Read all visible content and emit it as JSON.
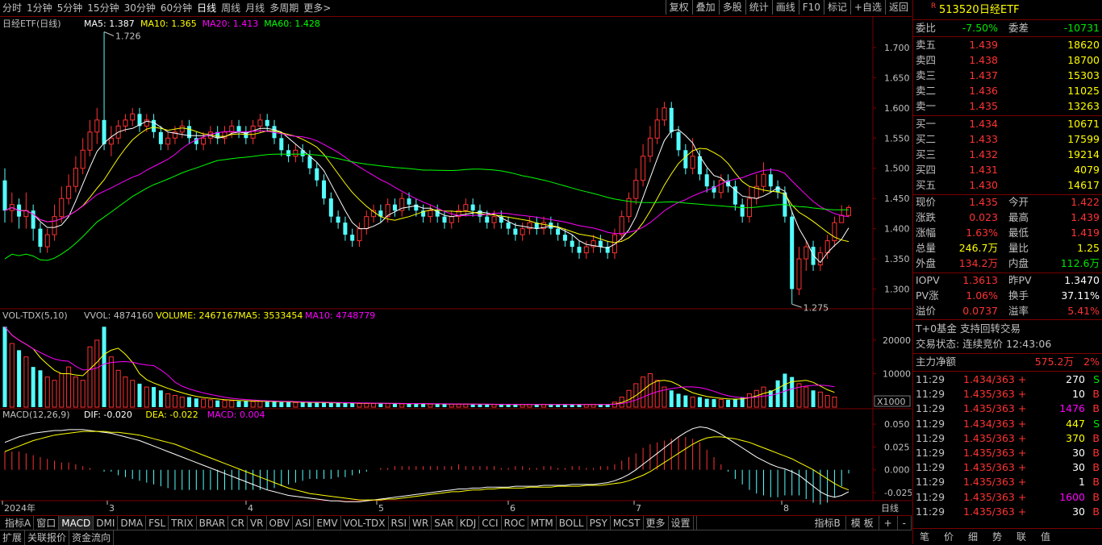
{
  "periods": [
    "分时",
    "1分钟",
    "5分钟",
    "15分钟",
    "30分钟",
    "60分钟",
    "日线",
    "周线",
    "月线",
    "多周期",
    "更多>"
  ],
  "active_period": "日线",
  "tools": [
    "复权",
    "叠加",
    "多股",
    "统计",
    "画线",
    "F10",
    "标记",
    "+自选",
    "返回"
  ],
  "main": {
    "title": "日经ETF(日线)",
    "ma": [
      {
        "label": "MA5: 1.387",
        "color": "#ffffff"
      },
      {
        "label": "MA10: 1.365",
        "color": "#ffff00"
      },
      {
        "label": "MA20: 1.413",
        "color": "#ff00ff"
      },
      {
        "label": "MA60: 1.428",
        "color": "#00ff00"
      }
    ],
    "high_label": "1.726",
    "low_label": "1.275",
    "y_ticks": [
      "1.700",
      "1.650",
      "1.600",
      "1.550",
      "1.500",
      "1.450",
      "1.400",
      "1.350",
      "1.300"
    ]
  },
  "volume": {
    "title": "VOL-TDX(5,10)",
    "items": [
      {
        "label": "VVOL: 4874160",
        "color": "#c0c0c0"
      },
      {
        "label": "VOLUME: 2467167",
        "color": "#ffff00"
      },
      {
        "label": "MA5: 3533454",
        "color": "#ffff00"
      },
      {
        "label": "MA10: 4748779",
        "color": "#ff00ff"
      }
    ],
    "y_ticks": [
      "20000",
      "10000"
    ],
    "unit": "X1000"
  },
  "macd": {
    "title": "MACD(12,26,9)",
    "items": [
      {
        "label": "DIF: -0.020",
        "color": "#ffffff"
      },
      {
        "label": "DEA: -0.022",
        "color": "#ffff00"
      },
      {
        "label": "MACD: 0.004",
        "color": "#ff00ff"
      }
    ],
    "y_ticks": [
      "0.050",
      "0.025",
      "0.000",
      "-0.025"
    ]
  },
  "x_axis": {
    "labels": [
      "2024年",
      "3",
      "4",
      "5",
      "6",
      "7",
      "8"
    ],
    "right_label": "日线"
  },
  "chart_data": {
    "type": "candlestick",
    "ylim": [
      1.27,
      1.74
    ],
    "candles": [
      [
        1.48,
        1.43,
        1.5,
        1.41
      ],
      [
        1.43,
        1.44,
        1.46,
        1.41
      ],
      [
        1.44,
        1.42,
        1.45,
        1.4
      ],
      [
        1.42,
        1.43,
        1.46,
        1.4
      ],
      [
        1.43,
        1.4,
        1.44,
        1.38
      ],
      [
        1.4,
        1.37,
        1.41,
        1.36
      ],
      [
        1.37,
        1.39,
        1.4,
        1.36
      ],
      [
        1.39,
        1.42,
        1.44,
        1.38
      ],
      [
        1.42,
        1.45,
        1.47,
        1.41
      ],
      [
        1.45,
        1.47,
        1.49,
        1.44
      ],
      [
        1.47,
        1.5,
        1.52,
        1.46
      ],
      [
        1.5,
        1.53,
        1.55,
        1.49
      ],
      [
        1.53,
        1.56,
        1.58,
        1.52
      ],
      [
        1.56,
        1.58,
        1.6,
        1.54
      ],
      [
        1.58,
        1.54,
        1.726,
        1.53
      ],
      [
        1.54,
        1.55,
        1.57,
        1.52
      ],
      [
        1.55,
        1.57,
        1.58,
        1.54
      ],
      [
        1.57,
        1.58,
        1.59,
        1.56
      ],
      [
        1.58,
        1.59,
        1.6,
        1.57
      ],
      [
        1.59,
        1.57,
        1.6,
        1.56
      ],
      [
        1.57,
        1.58,
        1.59,
        1.56
      ],
      [
        1.58,
        1.56,
        1.59,
        1.55
      ],
      [
        1.56,
        1.54,
        1.57,
        1.53
      ],
      [
        1.54,
        1.55,
        1.56,
        1.53
      ],
      [
        1.55,
        1.56,
        1.57,
        1.54
      ],
      [
        1.56,
        1.57,
        1.58,
        1.55
      ],
      [
        1.57,
        1.55,
        1.58,
        1.54
      ],
      [
        1.55,
        1.54,
        1.56,
        1.53
      ],
      [
        1.54,
        1.55,
        1.56,
        1.53
      ],
      [
        1.55,
        1.56,
        1.57,
        1.54
      ],
      [
        1.56,
        1.55,
        1.57,
        1.54
      ],
      [
        1.55,
        1.56,
        1.57,
        1.54
      ],
      [
        1.56,
        1.57,
        1.58,
        1.55
      ],
      [
        1.57,
        1.56,
        1.58,
        1.55
      ],
      [
        1.56,
        1.55,
        1.57,
        1.54
      ],
      [
        1.55,
        1.57,
        1.58,
        1.54
      ],
      [
        1.57,
        1.58,
        1.59,
        1.56
      ],
      [
        1.58,
        1.57,
        1.59,
        1.56
      ],
      [
        1.57,
        1.55,
        1.58,
        1.54
      ],
      [
        1.55,
        1.53,
        1.56,
        1.52
      ],
      [
        1.53,
        1.52,
        1.54,
        1.51
      ],
      [
        1.52,
        1.53,
        1.54,
        1.51
      ],
      [
        1.53,
        1.52,
        1.54,
        1.51
      ],
      [
        1.52,
        1.5,
        1.53,
        1.49
      ],
      [
        1.5,
        1.48,
        1.51,
        1.47
      ],
      [
        1.48,
        1.45,
        1.49,
        1.44
      ],
      [
        1.45,
        1.42,
        1.46,
        1.41
      ],
      [
        1.42,
        1.41,
        1.43,
        1.4
      ],
      [
        1.41,
        1.39,
        1.42,
        1.38
      ],
      [
        1.39,
        1.38,
        1.4,
        1.37
      ],
      [
        1.38,
        1.4,
        1.41,
        1.37
      ],
      [
        1.4,
        1.42,
        1.43,
        1.39
      ],
      [
        1.42,
        1.43,
        1.44,
        1.41
      ],
      [
        1.43,
        1.42,
        1.44,
        1.41
      ],
      [
        1.42,
        1.44,
        1.45,
        1.41
      ],
      [
        1.44,
        1.43,
        1.45,
        1.42
      ],
      [
        1.43,
        1.45,
        1.46,
        1.42
      ],
      [
        1.45,
        1.44,
        1.46,
        1.43
      ],
      [
        1.44,
        1.43,
        1.45,
        1.42
      ],
      [
        1.43,
        1.42,
        1.44,
        1.41
      ],
      [
        1.42,
        1.43,
        1.44,
        1.41
      ],
      [
        1.43,
        1.42,
        1.44,
        1.41
      ],
      [
        1.42,
        1.41,
        1.43,
        1.4
      ],
      [
        1.41,
        1.42,
        1.43,
        1.4
      ],
      [
        1.42,
        1.43,
        1.44,
        1.41
      ],
      [
        1.43,
        1.44,
        1.45,
        1.42
      ],
      [
        1.44,
        1.43,
        1.45,
        1.42
      ],
      [
        1.43,
        1.42,
        1.44,
        1.41
      ],
      [
        1.42,
        1.41,
        1.43,
        1.4
      ],
      [
        1.41,
        1.42,
        1.43,
        1.4
      ],
      [
        1.42,
        1.41,
        1.43,
        1.4
      ],
      [
        1.41,
        1.4,
        1.42,
        1.39
      ],
      [
        1.4,
        1.39,
        1.41,
        1.38
      ],
      [
        1.39,
        1.4,
        1.41,
        1.38
      ],
      [
        1.4,
        1.41,
        1.42,
        1.39
      ],
      [
        1.41,
        1.4,
        1.42,
        1.39
      ],
      [
        1.4,
        1.41,
        1.42,
        1.39
      ],
      [
        1.41,
        1.4,
        1.42,
        1.39
      ],
      [
        1.4,
        1.39,
        1.41,
        1.38
      ],
      [
        1.39,
        1.38,
        1.4,
        1.37
      ],
      [
        1.38,
        1.37,
        1.39,
        1.36
      ],
      [
        1.37,
        1.36,
        1.38,
        1.35
      ],
      [
        1.36,
        1.37,
        1.38,
        1.35
      ],
      [
        1.37,
        1.38,
        1.39,
        1.36
      ],
      [
        1.38,
        1.37,
        1.39,
        1.36
      ],
      [
        1.37,
        1.36,
        1.38,
        1.35
      ],
      [
        1.36,
        1.39,
        1.4,
        1.35
      ],
      [
        1.39,
        1.42,
        1.43,
        1.38
      ],
      [
        1.42,
        1.45,
        1.46,
        1.41
      ],
      [
        1.45,
        1.48,
        1.5,
        1.44
      ],
      [
        1.48,
        1.52,
        1.54,
        1.47
      ],
      [
        1.52,
        1.55,
        1.57,
        1.51
      ],
      [
        1.55,
        1.58,
        1.6,
        1.54
      ],
      [
        1.58,
        1.6,
        1.61,
        1.57
      ],
      [
        1.6,
        1.56,
        1.61,
        1.55
      ],
      [
        1.56,
        1.53,
        1.57,
        1.52
      ],
      [
        1.53,
        1.5,
        1.54,
        1.49
      ],
      [
        1.5,
        1.52,
        1.55,
        1.49
      ],
      [
        1.52,
        1.49,
        1.53,
        1.48
      ],
      [
        1.49,
        1.47,
        1.5,
        1.46
      ],
      [
        1.47,
        1.46,
        1.48,
        1.45
      ],
      [
        1.46,
        1.48,
        1.49,
        1.45
      ],
      [
        1.48,
        1.47,
        1.49,
        1.46
      ],
      [
        1.47,
        1.44,
        1.48,
        1.43
      ],
      [
        1.44,
        1.42,
        1.45,
        1.41
      ],
      [
        1.42,
        1.45,
        1.47,
        1.41
      ],
      [
        1.45,
        1.47,
        1.49,
        1.44
      ],
      [
        1.47,
        1.49,
        1.51,
        1.46
      ],
      [
        1.49,
        1.47,
        1.5,
        1.46
      ],
      [
        1.47,
        1.46,
        1.48,
        1.45
      ],
      [
        1.46,
        1.42,
        1.47,
        1.41
      ],
      [
        1.42,
        1.3,
        1.43,
        1.275
      ],
      [
        1.3,
        1.35,
        1.37,
        1.29
      ],
      [
        1.35,
        1.37,
        1.38,
        1.33
      ],
      [
        1.37,
        1.34,
        1.38,
        1.33
      ],
      [
        1.34,
        1.36,
        1.37,
        1.33
      ],
      [
        1.36,
        1.38,
        1.39,
        1.35
      ],
      [
        1.38,
        1.41,
        1.42,
        1.37
      ],
      [
        1.41,
        1.422,
        1.439,
        1.419
      ],
      [
        1.422,
        1.435,
        1.439,
        1.419
      ]
    ],
    "volume": [
      24,
      19,
      17,
      15,
      12,
      11,
      9,
      8,
      10,
      12,
      9,
      8,
      18,
      20,
      24,
      15,
      11,
      9,
      8,
      7,
      6,
      6,
      5,
      4,
      3.5,
      3,
      3,
      2.6,
      2.4,
      2.2,
      2,
      2,
      1.9,
      1.8,
      1.8,
      1.7,
      1.7,
      1.6,
      1.6,
      1.5,
      1.5,
      1.4,
      1.4,
      1.3,
      1.3,
      1.3,
      1.2,
      1.2,
      1.2,
      1.2,
      1.1,
      1.1,
      1.1,
      1.1,
      1.1,
      1.0,
      1.0,
      1.0,
      1.0,
      1.0,
      0.9,
      0.9,
      0.9,
      0.9,
      0.9,
      0.9,
      0.8,
      0.8,
      0.8,
      0.8,
      0.8,
      0.8,
      0.8,
      0.8,
      0.8,
      0.8,
      0.8,
      0.8,
      0.8,
      0.8,
      0.8,
      0.8,
      0.8,
      0.8,
      0.8,
      0.8,
      1.5,
      3,
      5,
      7,
      9,
      10,
      8,
      6,
      5,
      4,
      3.5,
      3,
      3,
      2.5,
      2.4,
      2.3,
      2.2,
      2.5,
      3,
      4,
      5,
      6,
      5,
      8,
      10,
      9,
      7,
      6,
      5,
      4.5,
      3.5,
      3
    ],
    "volume_ylim": [
      0,
      26000
    ],
    "dif": [
      0.03,
      0.033,
      0.036,
      0.038,
      0.04,
      0.041,
      0.042,
      0.043,
      0.043,
      0.044,
      0.044,
      0.044,
      0.043,
      0.042,
      0.041,
      0.04,
      0.038,
      0.036,
      0.034,
      0.032,
      0.029,
      0.026,
      0.023,
      0.02,
      0.017,
      0.014,
      0.011,
      0.008,
      0.005,
      0.002,
      -0.001,
      -0.004,
      -0.007,
      -0.01,
      -0.013,
      -0.016,
      -0.019,
      -0.022,
      -0.024,
      -0.026,
      -0.028,
      -0.029,
      -0.03,
      -0.031,
      -0.032,
      -0.033,
      -0.034,
      -0.034,
      -0.035,
      -0.035,
      -0.035,
      -0.034,
      -0.033,
      -0.032,
      -0.031,
      -0.03,
      -0.029,
      -0.028,
      -0.027,
      -0.026,
      -0.025,
      -0.024,
      -0.023,
      -0.022,
      -0.021,
      -0.021,
      -0.02,
      -0.02,
      -0.019,
      -0.019,
      -0.019,
      -0.019,
      -0.018,
      -0.018,
      -0.018,
      -0.018,
      -0.017,
      -0.017,
      -0.017,
      -0.017,
      -0.016,
      -0.016,
      -0.016,
      -0.016,
      -0.015,
      -0.014,
      -0.012,
      -0.009,
      -0.005,
      0.0,
      0.006,
      0.012,
      0.018,
      0.024,
      0.03,
      0.036,
      0.041,
      0.045,
      0.047,
      0.046,
      0.043,
      0.039,
      0.034,
      0.029,
      0.024,
      0.019,
      0.014,
      0.01,
      0.006,
      0.003,
      0.001,
      -0.002,
      -0.006,
      -0.012,
      -0.018,
      -0.024,
      -0.028,
      -0.03,
      -0.028,
      -0.024
    ],
    "dea": [
      0.02,
      0.023,
      0.026,
      0.029,
      0.032,
      0.034,
      0.036,
      0.038,
      0.039,
      0.04,
      0.041,
      0.042,
      0.042,
      0.042,
      0.042,
      0.041,
      0.041,
      0.04,
      0.039,
      0.038,
      0.036,
      0.034,
      0.032,
      0.03,
      0.028,
      0.025,
      0.022,
      0.019,
      0.016,
      0.013,
      0.01,
      0.007,
      0.004,
      0.001,
      -0.002,
      -0.005,
      -0.008,
      -0.011,
      -0.014,
      -0.017,
      -0.02,
      -0.022,
      -0.024,
      -0.026,
      -0.027,
      -0.028,
      -0.029,
      -0.03,
      -0.031,
      -0.032,
      -0.033,
      -0.033,
      -0.033,
      -0.033,
      -0.032,
      -0.032,
      -0.031,
      -0.03,
      -0.029,
      -0.028,
      -0.027,
      -0.026,
      -0.025,
      -0.024,
      -0.024,
      -0.023,
      -0.022,
      -0.022,
      -0.021,
      -0.021,
      -0.02,
      -0.02,
      -0.02,
      -0.02,
      -0.019,
      -0.019,
      -0.019,
      -0.019,
      -0.018,
      -0.018,
      -0.018,
      -0.018,
      -0.017,
      -0.017,
      -0.017,
      -0.016,
      -0.015,
      -0.014,
      -0.012,
      -0.009,
      -0.006,
      -0.002,
      0.003,
      0.008,
      0.013,
      0.018,
      0.023,
      0.028,
      0.032,
      0.035,
      0.036,
      0.036,
      0.035,
      0.034,
      0.032,
      0.03,
      0.027,
      0.024,
      0.021,
      0.018,
      0.015,
      0.012,
      0.008,
      0.004,
      0.0,
      -0.005,
      -0.01,
      -0.015,
      -0.019,
      -0.022
    ],
    "macd_ylim": [
      -0.032,
      0.058
    ]
  },
  "panel": {
    "code": "513520",
    "name": "日经ETF",
    "wei": {
      "label1": "委比",
      "v1": "-7.50%",
      "label2": "委差",
      "v2": "-10731"
    },
    "sell": [
      {
        "label": "卖五",
        "price": "1.439",
        "vol": "18620"
      },
      {
        "label": "卖四",
        "price": "1.438",
        "vol": "18700"
      },
      {
        "label": "卖三",
        "price": "1.437",
        "vol": "15303"
      },
      {
        "label": "卖二",
        "price": "1.436",
        "vol": "11025"
      },
      {
        "label": "卖一",
        "price": "1.435",
        "vol": "13263"
      }
    ],
    "buy": [
      {
        "label": "买一",
        "price": "1.434",
        "vol": "10671"
      },
      {
        "label": "买二",
        "price": "1.433",
        "vol": "17599"
      },
      {
        "label": "买三",
        "price": "1.432",
        "vol": "19214"
      },
      {
        "label": "买四",
        "price": "1.431",
        "vol": "4079"
      },
      {
        "label": "买五",
        "price": "1.430",
        "vol": "14617"
      }
    ],
    "quote": [
      {
        "l1": "现价",
        "v1": "1.435",
        "c1": "red",
        "l2": "今开",
        "v2": "1.422",
        "c2": "red"
      },
      {
        "l1": "涨跌",
        "v1": "0.023",
        "c1": "red",
        "l2": "最高",
        "v2": "1.439",
        "c2": "red"
      },
      {
        "l1": "涨幅",
        "v1": "1.63%",
        "c1": "red",
        "l2": "最低",
        "v2": "1.419",
        "c2": "red"
      },
      {
        "l1": "总量",
        "v1": "246.7万",
        "c1": "yellow",
        "l2": "量比",
        "v2": "1.25",
        "c2": "yellow"
      },
      {
        "l1": "外盘",
        "v1": "134.2万",
        "c1": "red",
        "l2": "内盘",
        "v2": "112.6万",
        "c2": "green"
      }
    ],
    "iopv": [
      {
        "l1": "IOPV",
        "v1": "1.3613",
        "c1": "red",
        "l2": "昨PV",
        "v2": "1.3470",
        "c2": "white"
      },
      {
        "l1": "PV涨",
        "v1": "1.06%",
        "c1": "red",
        "l2": "换手",
        "v2": "37.11%",
        "c2": "white"
      },
      {
        "l1": "溢价",
        "v1": "0.0737",
        "c1": "red",
        "l2": "溢率",
        "v2": "5.41%",
        "c2": "red"
      }
    ],
    "t0": "T+0基金 支持回转交易",
    "status": "交易状态: 连续竞价 12:43:06",
    "main_force": {
      "label": "主力净额",
      "value": "575.2万",
      "pct": "2%"
    },
    "trades": [
      {
        "time": "11:29",
        "price": "1.434/363 +",
        "vol": "270",
        "vc": "white",
        "bs": "S",
        "bc": "green"
      },
      {
        "time": "11:29",
        "price": "1.435/363 +",
        "vol": "10",
        "vc": "white",
        "bs": "B",
        "bc": "red"
      },
      {
        "time": "11:29",
        "price": "1.435/363 +",
        "vol": "1476",
        "vc": "magenta",
        "bs": "B",
        "bc": "red"
      },
      {
        "time": "11:29",
        "price": "1.434/363 +",
        "vol": "447",
        "vc": "yellow",
        "bs": "S",
        "bc": "green"
      },
      {
        "time": "11:29",
        "price": "1.435/363 +",
        "vol": "370",
        "vc": "yellow",
        "bs": "B",
        "bc": "red"
      },
      {
        "time": "11:29",
        "price": "1.435/363 +",
        "vol": "30",
        "vc": "white",
        "bs": "B",
        "bc": "red"
      },
      {
        "time": "11:29",
        "price": "1.435/363 +",
        "vol": "30",
        "vc": "white",
        "bs": "B",
        "bc": "red"
      },
      {
        "time": "11:29",
        "price": "1.435/363 +",
        "vol": "1",
        "vc": "white",
        "bs": "B",
        "bc": "red"
      },
      {
        "time": "11:29",
        "price": "1.435/363 +",
        "vol": "1600",
        "vc": "magenta",
        "bs": "B",
        "bc": "red"
      },
      {
        "time": "11:29",
        "price": "1.435/363 +",
        "vol": "30",
        "vc": "white",
        "bs": "B",
        "bc": "red"
      }
    ],
    "tabs": [
      "笔",
      "价",
      "细",
      "势",
      "联",
      "值"
    ]
  },
  "indicator_tabs": [
    "指标A",
    "窗口",
    "MACD",
    "DMI",
    "DMA",
    "FSL",
    "TRIX",
    "BRAR",
    "CR",
    "VR",
    "OBV",
    "ASI",
    "EMV",
    "VOL-TDX",
    "RSI",
    "WR",
    "SAR",
    "KDJ",
    "CCI",
    "ROC",
    "MTM",
    "BOLL",
    "PSY",
    "MCST",
    "更多",
    "设置"
  ],
  "indicator_right": [
    "指标B",
    "模 板",
    "+",
    "-"
  ],
  "bottom_tabs": [
    "扩展",
    "关联报价",
    "资金流向"
  ],
  "colors": {
    "up": "#ff3232",
    "down": "#54ffff",
    "ma5": "#ffffff",
    "ma10": "#ffff00",
    "ma20": "#ff00ff",
    "ma60": "#00ff00",
    "grid": "#7a0000"
  }
}
